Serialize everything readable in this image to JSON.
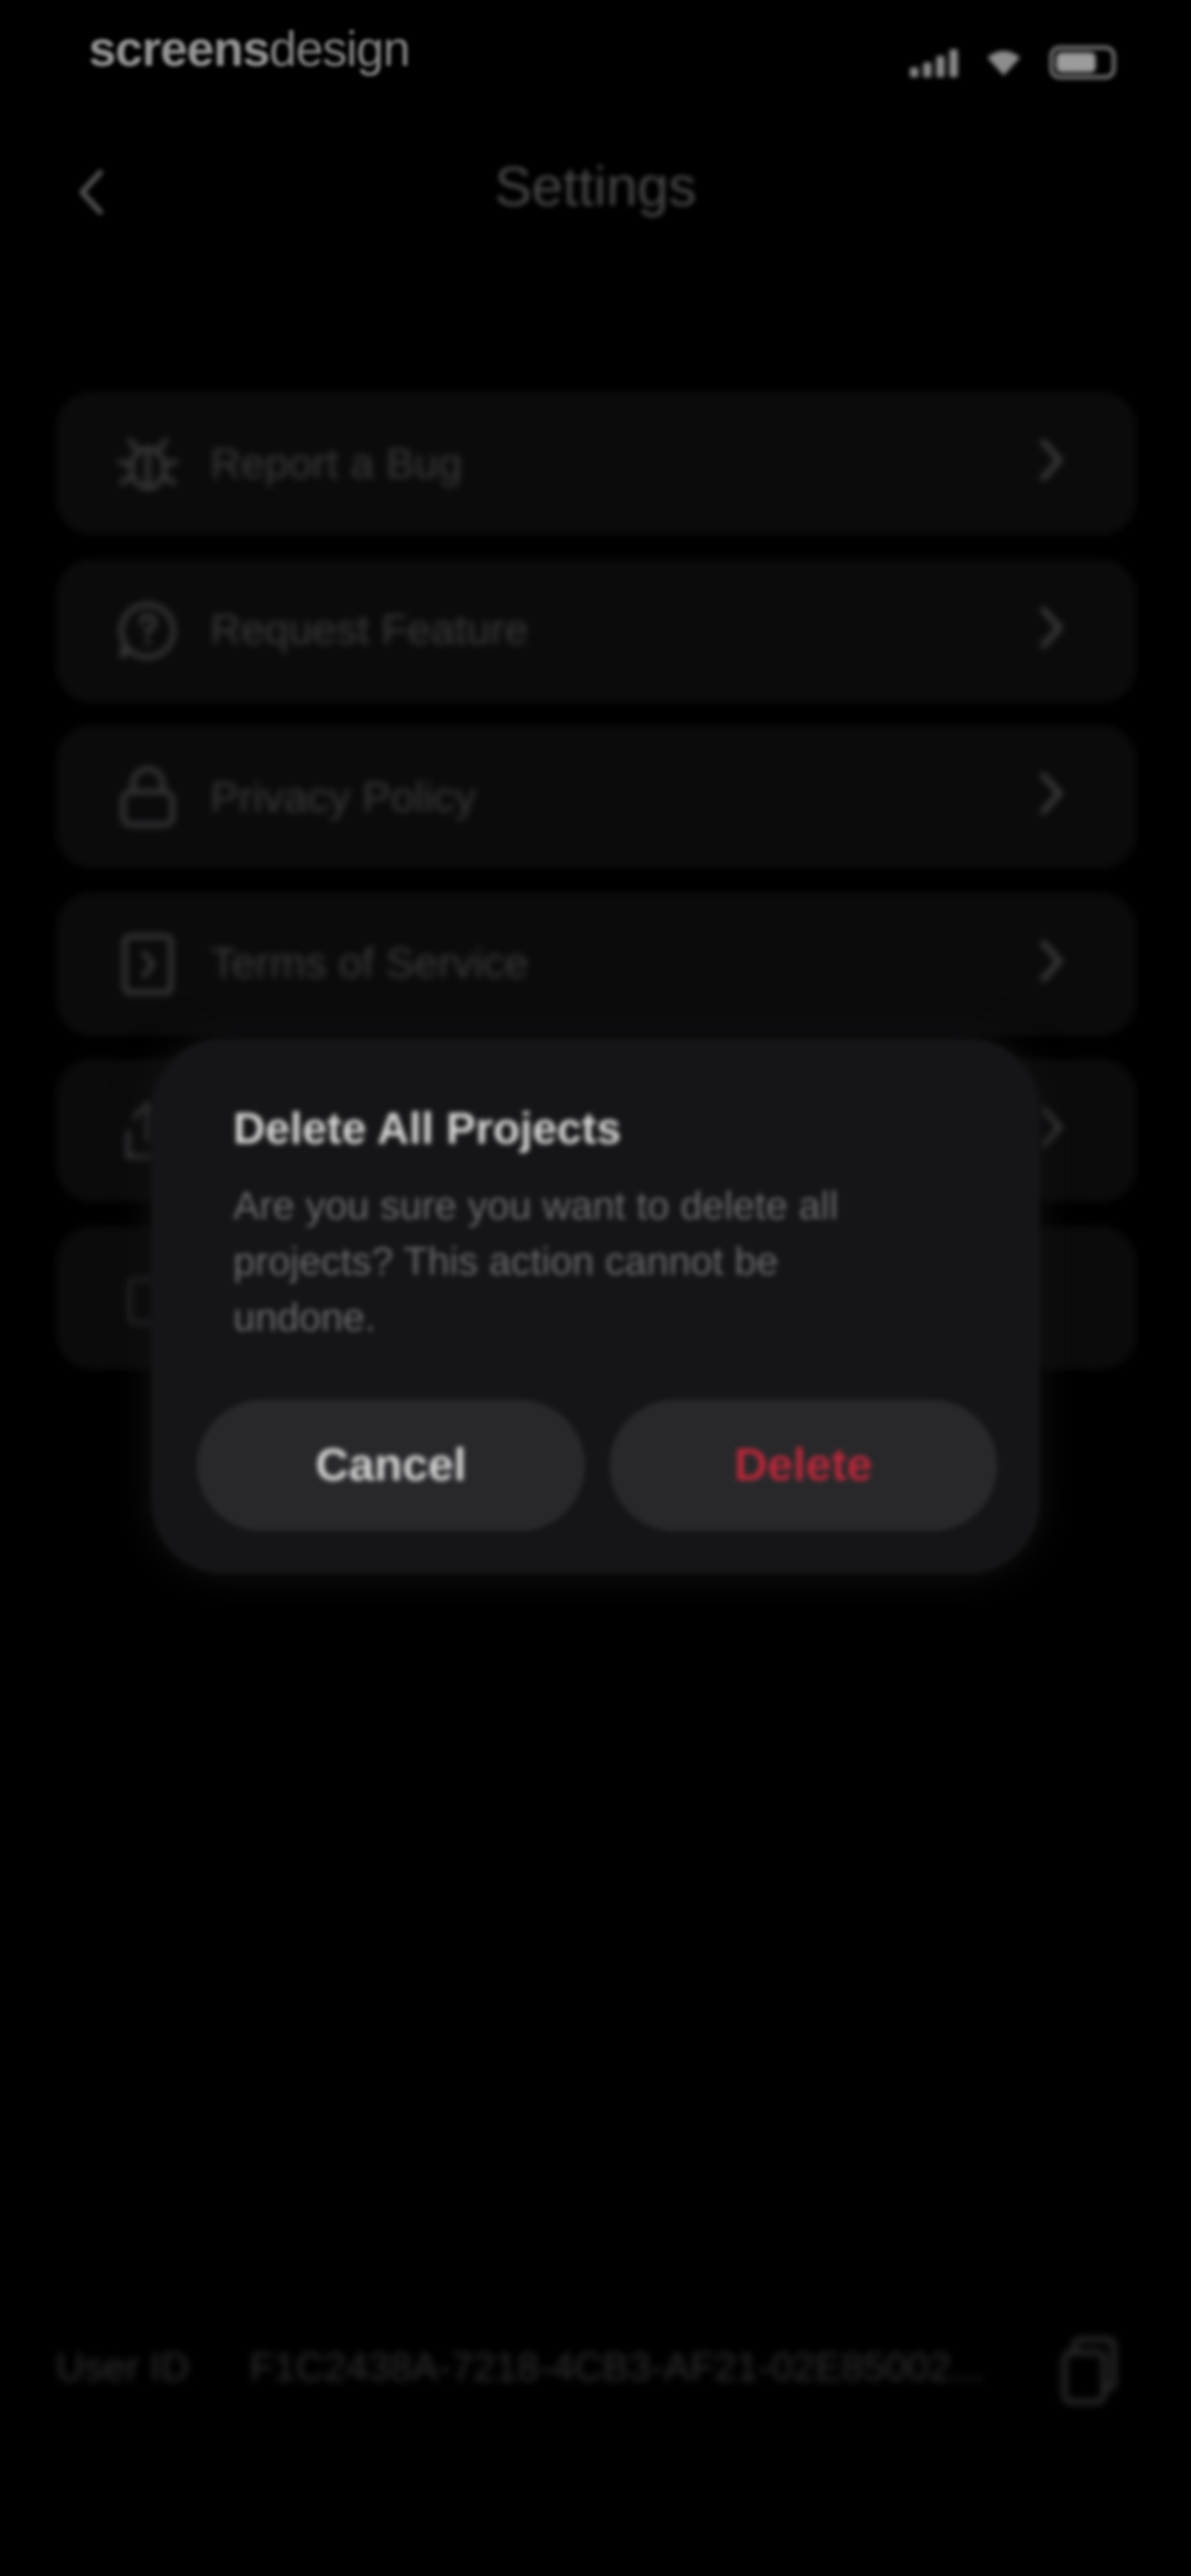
{
  "status_bar": {
    "brand_bold": "screens",
    "brand_light": "design"
  },
  "header": {
    "back_icon": "chevron-left-icon",
    "title": "Settings"
  },
  "settings": {
    "items": [
      {
        "label": "Report a Bug",
        "icon": "bug-icon"
      },
      {
        "label": "Request Feature",
        "icon": "chat-question-icon"
      },
      {
        "label": "Privacy Policy",
        "icon": "lock-icon"
      },
      {
        "label": "Terms of Service",
        "icon": "document-icon"
      },
      {
        "label": "",
        "icon": "share-icon"
      },
      {
        "label": "",
        "icon": "trash-icon"
      }
    ]
  },
  "dialog": {
    "title": "Delete All Projects",
    "message": "Are you sure you want to delete all projects? This action cannot be undone.",
    "cancel_label": "Cancel",
    "delete_label": "Delete",
    "delete_color": "#b8283a"
  },
  "footer": {
    "user_id_label": "User ID",
    "user_id_value": "F1C2438A-7218-4CB3-AF21-02E85002...",
    "copy_icon": "copy-icon"
  }
}
